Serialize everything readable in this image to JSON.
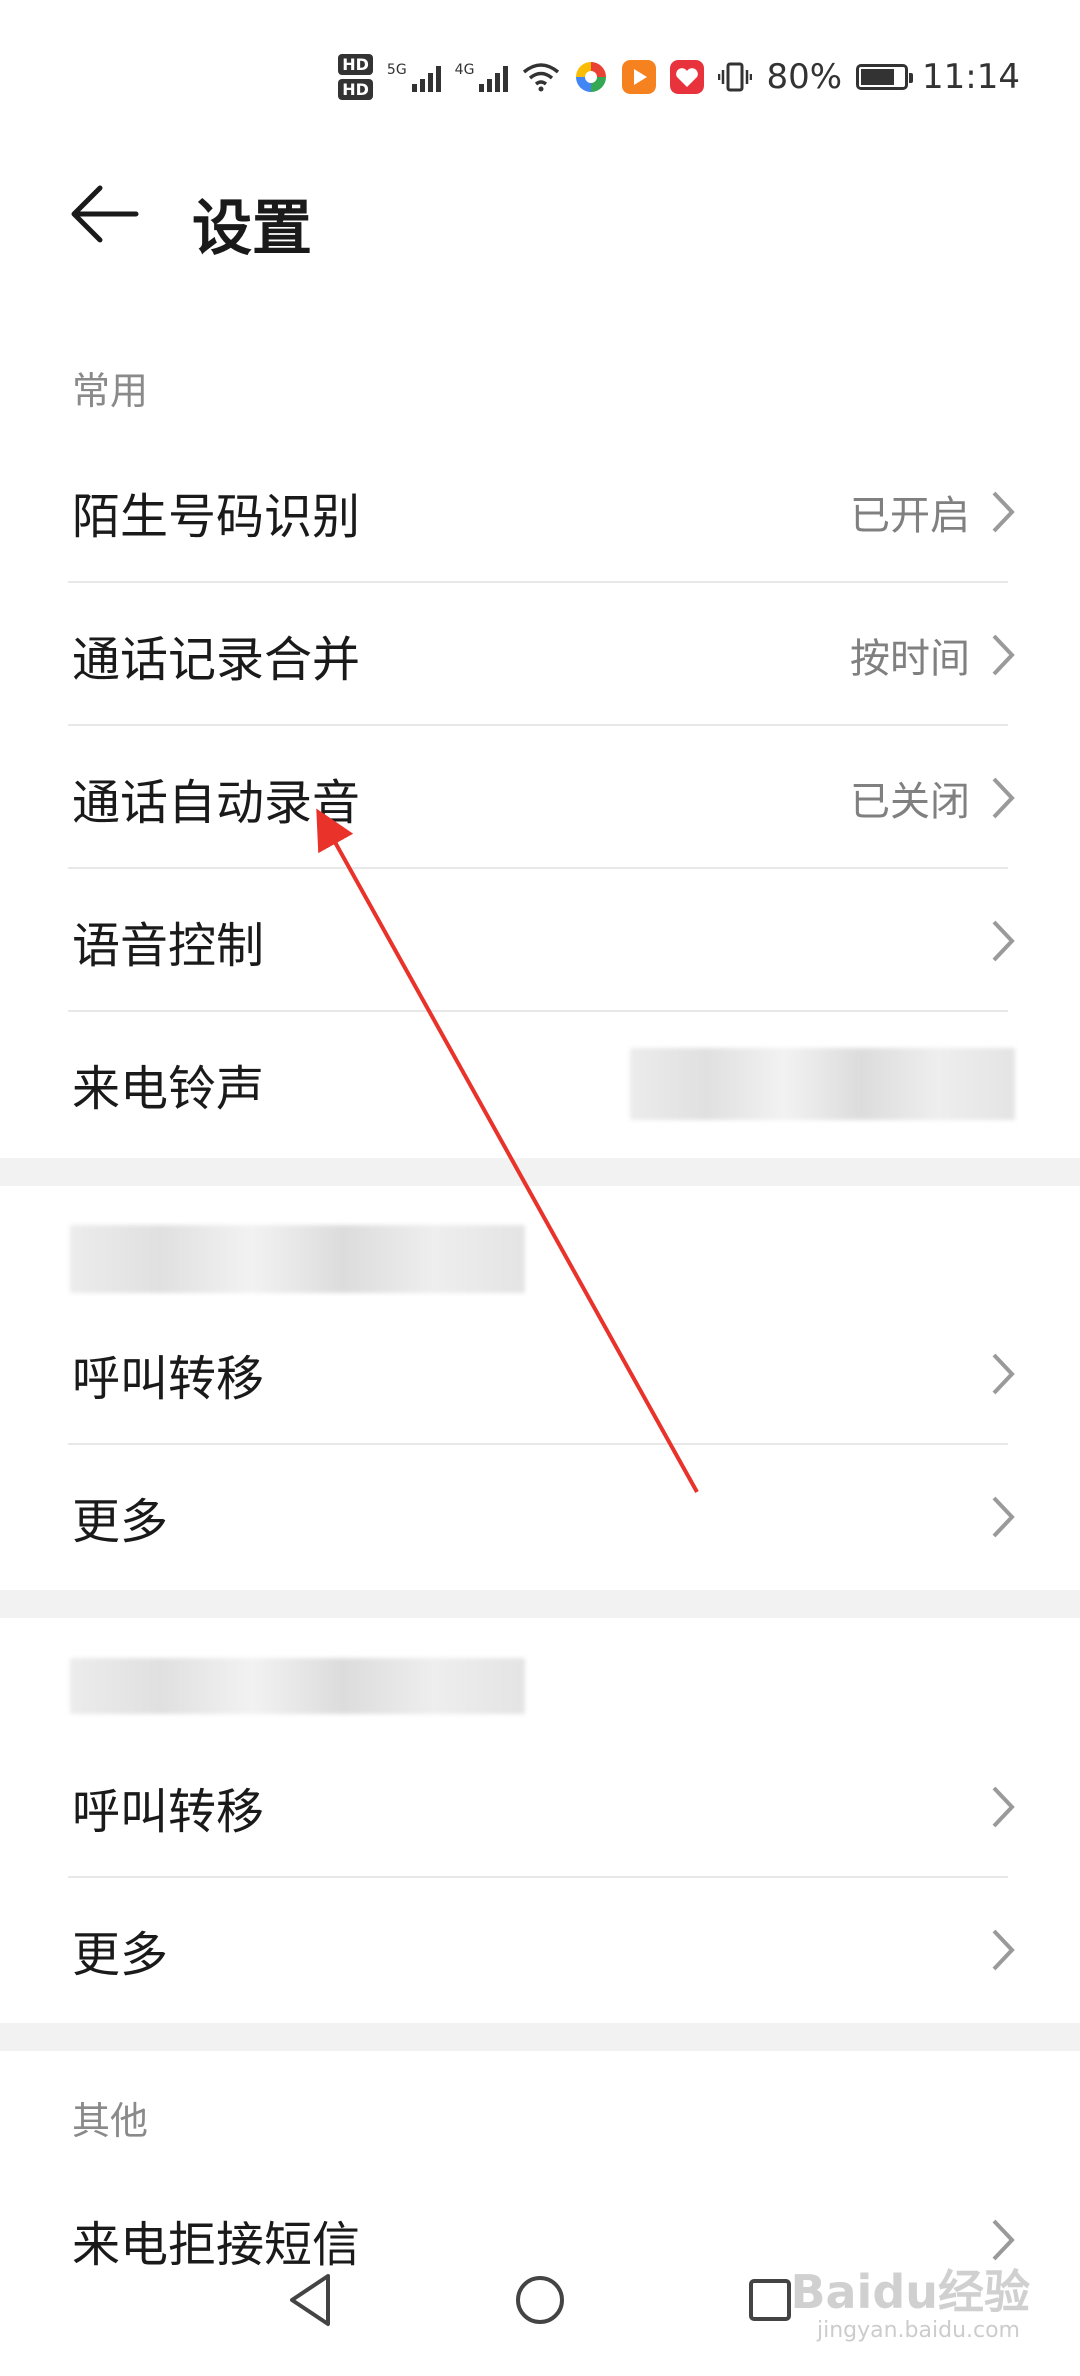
{
  "status_bar": {
    "hd1": "HD",
    "hd2": "HD",
    "net1": "5G",
    "net2": "4G",
    "battery_percent": "80%",
    "battery_level": 0.8,
    "time": "11:14",
    "icons": [
      "hd-icon",
      "signal-icon",
      "wifi-icon",
      "app-icon",
      "vibrate-icon",
      "battery-icon"
    ]
  },
  "header": {
    "title": "设置",
    "back_icon": "arrow-left-icon"
  },
  "sections": {
    "common": {
      "label": "常用",
      "items": [
        {
          "label": "陌生号码识别",
          "value": "已开启"
        },
        {
          "label": "通话记录合并",
          "value": "按时间"
        },
        {
          "label": "通话自动录音",
          "value": "已关闭"
        },
        {
          "label": "语音控制",
          "value": ""
        },
        {
          "label": "来电铃声",
          "value": ""
        }
      ]
    },
    "sim1": {
      "items": [
        {
          "label": "呼叫转移"
        },
        {
          "label": "更多"
        }
      ]
    },
    "sim2": {
      "items": [
        {
          "label": "呼叫转移"
        },
        {
          "label": "更多"
        }
      ]
    },
    "other": {
      "label": "其他",
      "items": [
        {
          "label": "来电拒接短信"
        }
      ]
    }
  },
  "watermark": {
    "main": "Baidu经验",
    "sub": "jingyan.baidu.com"
  },
  "colors": {
    "annotation_arrow": "#e8322a",
    "text_primary": "#1a1a1a",
    "text_secondary": "#808080"
  }
}
